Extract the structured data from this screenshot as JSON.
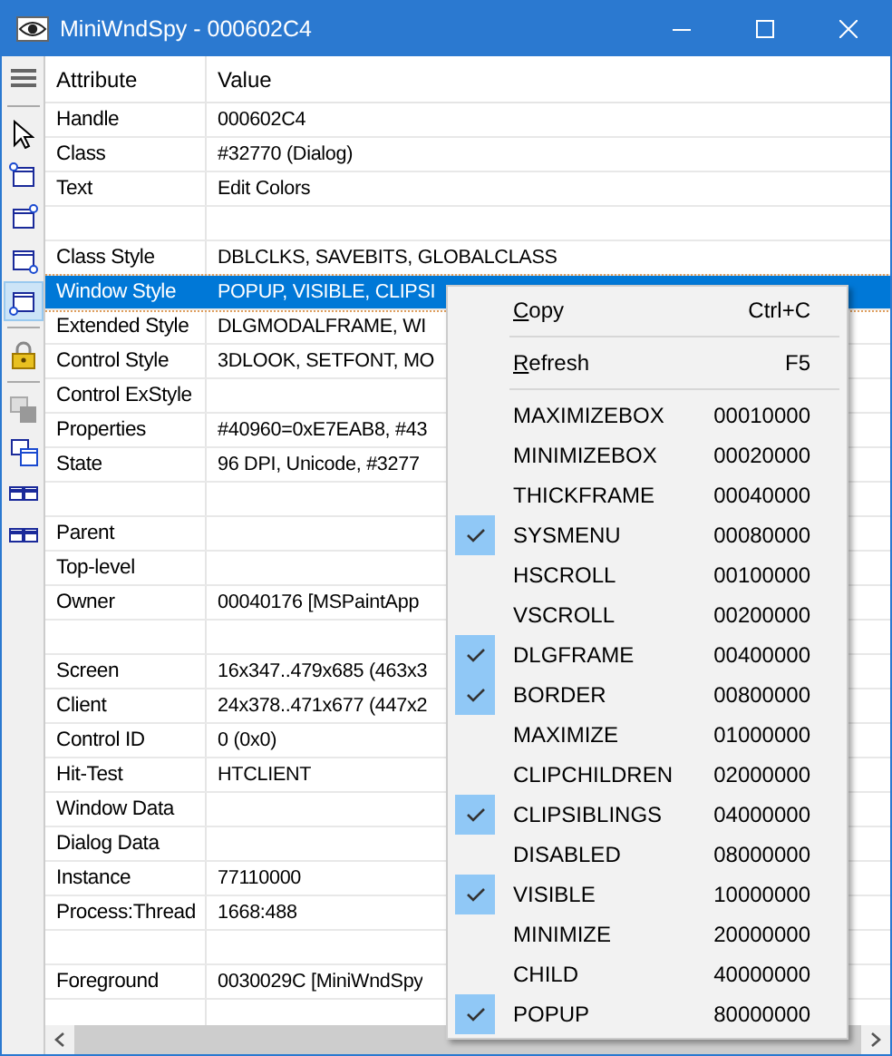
{
  "window": {
    "title": "MiniWndSpy - 000602C4"
  },
  "toolbar": [
    {
      "kind": "menu",
      "selected": false
    },
    {
      "kind": "pointer",
      "selected": false
    },
    {
      "kind": "win-tl",
      "selected": false
    },
    {
      "kind": "win-tr",
      "selected": false
    },
    {
      "kind": "win-br",
      "selected": false
    },
    {
      "kind": "win-bl",
      "selected": true
    },
    {
      "kind": "lock",
      "selected": false
    },
    {
      "kind": "stack-grey",
      "selected": false
    },
    {
      "kind": "stack-blue",
      "selected": false
    },
    {
      "kind": "pair",
      "selected": false
    },
    {
      "kind": "pair",
      "selected": false
    }
  ],
  "table": {
    "columns": [
      "Attribute",
      "Value"
    ],
    "rows": [
      {
        "kind": "data",
        "attribute": "Handle",
        "value": "000602C4",
        "selected": false
      },
      {
        "kind": "data",
        "attribute": "Class",
        "value": "#32770 (Dialog)",
        "selected": false
      },
      {
        "kind": "data",
        "attribute": "Text",
        "value": "Edit Colors",
        "selected": false
      },
      {
        "kind": "blank"
      },
      {
        "kind": "data",
        "attribute": "Class Style",
        "value": "DBLCLKS, SAVEBITS, GLOBALCLASS",
        "selected": false
      },
      {
        "kind": "data",
        "attribute": "Window Style",
        "value": "POPUP, VISIBLE, CLIPSI",
        "selected": true
      },
      {
        "kind": "data",
        "attribute": "Extended Style",
        "value": "DLGMODALFRAME, WI",
        "selected": false
      },
      {
        "kind": "data",
        "attribute": "Control Style",
        "value": "3DLOOK, SETFONT, MO",
        "selected": false
      },
      {
        "kind": "data",
        "attribute": "Control ExStyle",
        "selected": false
      },
      {
        "kind": "data",
        "attribute": "Properties",
        "value": "#40960=0xE7EAB8, #43",
        "selected": false
      },
      {
        "kind": "data",
        "attribute": "State",
        "value": "96 DPI, Unicode, #3277",
        "selected": false
      },
      {
        "kind": "blank"
      },
      {
        "kind": "data",
        "attribute": "Parent",
        "selected": false
      },
      {
        "kind": "data",
        "attribute": "Top-level",
        "selected": false
      },
      {
        "kind": "data",
        "attribute": "Owner",
        "value": "00040176 [MSPaintApp",
        "selected": false
      },
      {
        "kind": "blank"
      },
      {
        "kind": "data",
        "attribute": "Screen",
        "value": "16x347..479x685 (463x3",
        "selected": false
      },
      {
        "kind": "data",
        "attribute": "Client",
        "value": "24x378..471x677 (447x2",
        "selected": false
      },
      {
        "kind": "data",
        "attribute": "Control ID",
        "value": "0 (0x0)",
        "selected": false
      },
      {
        "kind": "data",
        "attribute": "Hit-Test",
        "value": "HTCLIENT",
        "selected": false
      },
      {
        "kind": "data",
        "attribute": "Window Data",
        "selected": false
      },
      {
        "kind": "data",
        "attribute": "Dialog Data",
        "selected": false
      },
      {
        "kind": "data",
        "attribute": "Instance",
        "value": "77110000",
        "selected": false
      },
      {
        "kind": "data",
        "attribute": "Process:Thread",
        "value": "1668:488",
        "selected": false
      },
      {
        "kind": "blank"
      },
      {
        "kind": "data",
        "attribute": "Foreground",
        "value": "0030029C [MiniWndSpy",
        "selected": false
      },
      {
        "kind": "blank"
      }
    ]
  },
  "context_menu": {
    "commands": [
      {
        "label": "Copy",
        "shortcut": "Ctrl+C",
        "mnemonic_first": true
      },
      {
        "label": "Refresh",
        "shortcut": "F5",
        "mnemonic_first": true
      }
    ],
    "flags": [
      {
        "label": "MAXIMIZEBOX",
        "value": "00010000",
        "checked": false
      },
      {
        "label": "MINIMIZEBOX",
        "value": "00020000",
        "checked": false
      },
      {
        "label": "THICKFRAME",
        "value": "00040000",
        "checked": false
      },
      {
        "label": "SYSMENU",
        "value": "00080000",
        "checked": true
      },
      {
        "label": "HSCROLL",
        "value": "00100000",
        "checked": false
      },
      {
        "label": "VSCROLL",
        "value": "00200000",
        "checked": false
      },
      {
        "label": "DLGFRAME",
        "value": "00400000",
        "checked": true
      },
      {
        "label": "BORDER",
        "value": "00800000",
        "checked": true
      },
      {
        "label": "MAXIMIZE",
        "value": "01000000",
        "checked": false
      },
      {
        "label": "CLIPCHILDREN",
        "value": "02000000",
        "checked": false
      },
      {
        "label": "CLIPSIBLINGS",
        "value": "04000000",
        "checked": true
      },
      {
        "label": "DISABLED",
        "value": "08000000",
        "checked": false
      },
      {
        "label": "VISIBLE",
        "value": "10000000",
        "checked": true
      },
      {
        "label": "MINIMIZE",
        "value": "20000000",
        "checked": false
      },
      {
        "label": "CHILD",
        "value": "40000000",
        "checked": false
      },
      {
        "label": "POPUP",
        "value": "80000000",
        "checked": true
      }
    ]
  }
}
